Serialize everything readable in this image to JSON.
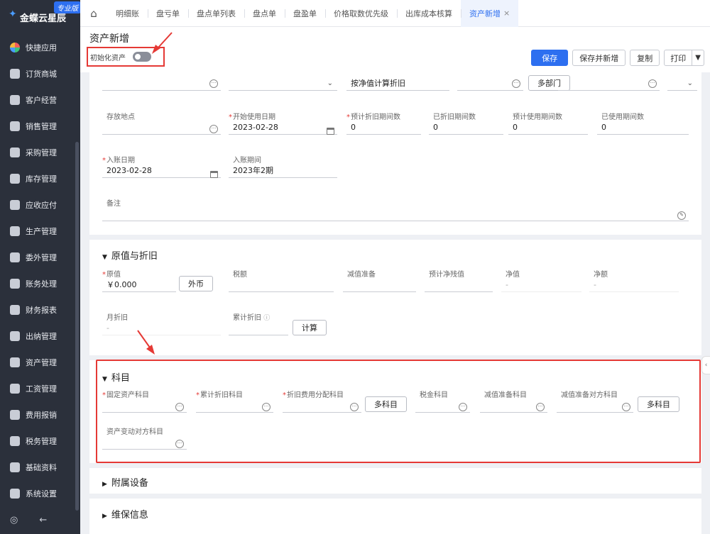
{
  "brand": {
    "name": "金蝶云星辰",
    "edition": "专业版"
  },
  "sidebar": {
    "items": [
      {
        "label": "快捷应用",
        "icon": "apps-icon"
      },
      {
        "label": "订货商城",
        "icon": "shop-bag-icon"
      },
      {
        "label": "客户经营",
        "icon": "customer-icon"
      },
      {
        "label": "销售管理",
        "icon": "sales-chart-icon"
      },
      {
        "label": "采购管理",
        "icon": "cart-icon"
      },
      {
        "label": "库存管理",
        "icon": "box-icon"
      },
      {
        "label": "应收应付",
        "icon": "exchange-icon"
      },
      {
        "label": "生产管理",
        "icon": "factory-icon"
      },
      {
        "label": "委外管理",
        "icon": "outsource-icon"
      },
      {
        "label": "账务处理",
        "icon": "ledger-icon"
      },
      {
        "label": "财务报表",
        "icon": "report-icon"
      },
      {
        "label": "出纳管理",
        "icon": "cashier-icon"
      },
      {
        "label": "资产管理",
        "icon": "asset-icon"
      },
      {
        "label": "工资管理",
        "icon": "payroll-icon"
      },
      {
        "label": "费用报销",
        "icon": "expense-icon"
      },
      {
        "label": "税务管理",
        "icon": "tax-icon"
      },
      {
        "label": "基础资料",
        "icon": "layers-icon"
      },
      {
        "label": "系统设置",
        "icon": "settings-icon"
      }
    ],
    "bottom": {
      "settings_icon": "◎",
      "collapse_icon": "←"
    }
  },
  "tabs": [
    {
      "label": "明细账",
      "active": false
    },
    {
      "label": "盘亏单",
      "active": false
    },
    {
      "label": "盘点单列表",
      "active": false
    },
    {
      "label": "盘点单",
      "active": false
    },
    {
      "label": "盘盈单",
      "active": false
    },
    {
      "label": "价格取数优先级",
      "active": false
    },
    {
      "label": "出库成本核算",
      "active": false
    },
    {
      "label": "资产新增",
      "active": true
    }
  ],
  "header": {
    "title": "资产新增",
    "init_label": "初始化资产",
    "init_toggle_on": false,
    "buttons": {
      "save": "保存",
      "save_new": "保存并新增",
      "copy": "复制",
      "print": "打印"
    }
  },
  "basic": {
    "row0": {
      "depr_method": "按净值计算折旧",
      "multi_dept": "多部门"
    },
    "storage_location": {
      "label": "存放地点",
      "value": ""
    },
    "start_date": {
      "label": "开始使用日期",
      "value": "2023-02-28"
    },
    "est_periods": {
      "label": "预计折旧期间数",
      "value": "0"
    },
    "depr_periods": {
      "label": "已折旧期间数",
      "value": "0"
    },
    "est_use_periods": {
      "label": "预计使用期间数",
      "value": "0"
    },
    "used_periods": {
      "label": "已使用期间数",
      "value": "0"
    },
    "entry_date": {
      "label": "入账日期",
      "value": "2023-02-28"
    },
    "entry_period": {
      "label": "入账期间",
      "value": "2023年2期"
    },
    "remark": {
      "label": "备注",
      "value": ""
    }
  },
  "original": {
    "title": "原值与折旧",
    "original_value": {
      "label": "原值",
      "value": "￥0.000"
    },
    "fx_button": "外币",
    "tax": {
      "label": "税额",
      "value": ""
    },
    "impairment": {
      "label": "减值准备",
      "value": ""
    },
    "est_residual": {
      "label": "预计净残值",
      "value": ""
    },
    "net_value": {
      "label": "净值",
      "value": "-"
    },
    "net_amount": {
      "label": "净额",
      "value": "-"
    },
    "monthly_depr": {
      "label": "月折旧",
      "value": "-"
    },
    "accum_depr": {
      "label": "累计折旧",
      "value": ""
    },
    "calc_button": "计算"
  },
  "accounts": {
    "title": "科目",
    "fixed_asset": "固定资产科目",
    "accum_depr": "累计折旧科目",
    "depr_expense": "折旧费用分配科目",
    "multi_button": "多科目",
    "tax": "税金科目",
    "impairment": "减值准备科目",
    "impairment_offset": "减值准备对方科目",
    "change_offset": "资产变动对方科目"
  },
  "attached": {
    "title": "附属设备"
  },
  "maintenance": {
    "title": "维保信息"
  }
}
